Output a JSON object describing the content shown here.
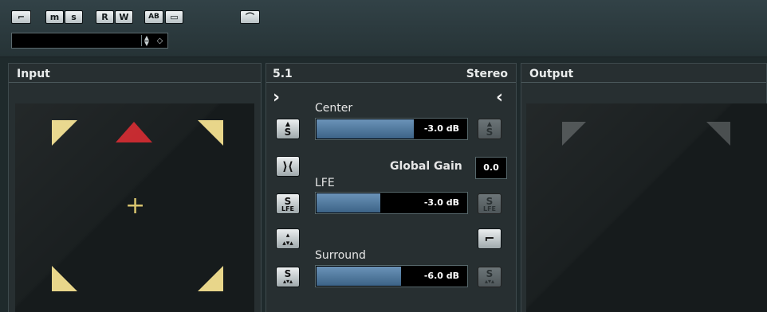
{
  "toolbar": {
    "buttons": [
      {
        "id": "window-toggle",
        "label": "",
        "glyph": "⌐"
      },
      {
        "id": "mute",
        "label": "m"
      },
      {
        "id": "solo",
        "label": "s"
      },
      {
        "id": "read",
        "label": "R"
      },
      {
        "id": "write",
        "label": "W"
      },
      {
        "id": "ab-compare",
        "label": "AB"
      },
      {
        "id": "preset-menu",
        "label": "",
        "glyph": "▭"
      },
      {
        "id": "lock",
        "label": "",
        "glyph": "⌒"
      }
    ],
    "preset_field": {
      "value": ""
    }
  },
  "input": {
    "title": "Input"
  },
  "mixer": {
    "source_format": "5.1",
    "target_format": "Stereo",
    "center": {
      "label": "Center",
      "value": "-3.0 dB",
      "level": 0.64
    },
    "global_gain": {
      "label": "Global Gain",
      "value": "0.0"
    },
    "lfe": {
      "label": "LFE",
      "value": "-3.0 dB",
      "level": 0.42
    },
    "surround": {
      "label": "Surround",
      "value": "-6.0 dB",
      "level": 0.56
    },
    "icons": {
      "solo": "S",
      "lfe_sub": "LFE"
    }
  },
  "output": {
    "title": "Output"
  },
  "colors": {
    "speaker_active": "#e8d68a",
    "speaker_center": "#c4252b",
    "speaker_inactive": "#4a4f50",
    "meter": "#4d7aa3"
  }
}
